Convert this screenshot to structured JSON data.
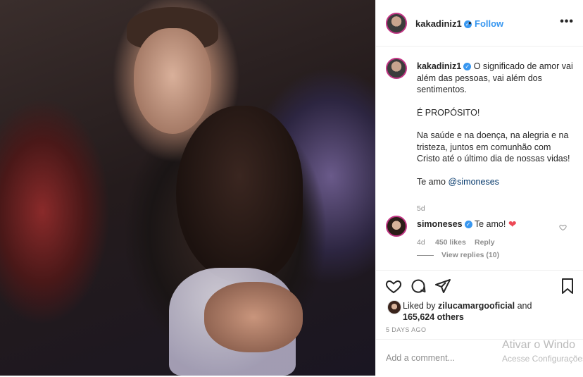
{
  "post": {
    "username": "kakadiniz1",
    "follow_label": "Follow",
    "more_label": "•••",
    "caption": {
      "username": "kakadiniz1",
      "line1": "O significado de amor vai além das pessoas, vai além dos sentimentos.",
      "line2": "É PROPÓSITO!",
      "line3": "Na saúde e na doença, na alegria e na tristeza, juntos em comunhão com Cristo até o último dia de nossas vidas!",
      "line4_prefix": "Te amo ",
      "line4_mention": "@simoneses",
      "age": "5d"
    },
    "comment": {
      "username": "simoneses",
      "text": "Te amo!",
      "emoji": "❤",
      "age": "4d",
      "likes": "450 likes",
      "reply_label": "Reply",
      "view_replies": "View replies (10)"
    },
    "likes": {
      "prefix": "Liked by ",
      "user": "zilucamargooficial",
      "middle": " and",
      "others": "165,624 others"
    },
    "date": "5 DAYS AGO",
    "add_comment_placeholder": "Add a comment..."
  },
  "windows_watermark": {
    "line1": "Ativar o Windo",
    "line2": "Acesse Configurações"
  },
  "icons": [
    "heart-icon",
    "comment-icon",
    "share-icon",
    "bookmark-icon",
    "more-icon",
    "verified-badge-icon"
  ],
  "colors": {
    "accent": "#3897f0",
    "ring": "#c13584",
    "heart": "#ed4956"
  }
}
